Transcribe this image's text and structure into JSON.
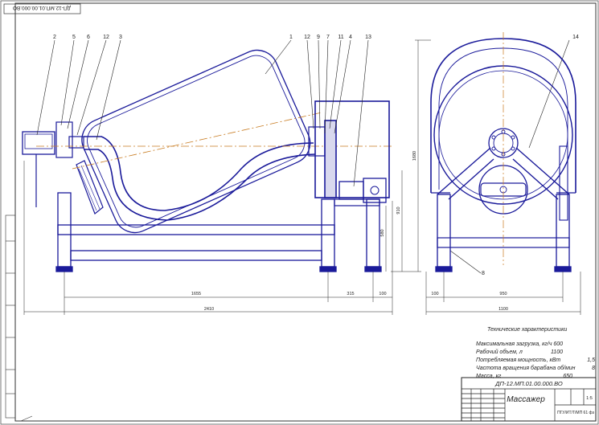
{
  "stamp_code": "ДП-12.МП.01.00.000.ВО",
  "callouts": {
    "c2": "2",
    "c5": "5",
    "c6": "6",
    "c12a": "12",
    "c3": "3",
    "c1": "1",
    "c12b": "12",
    "c9": "9",
    "c7": "7",
    "c11": "11",
    "c4": "4",
    "c13": "13",
    "c14": "14",
    "c8": "8"
  },
  "dims": {
    "d1655": "1655",
    "d315": "315",
    "d100a": "100",
    "d2410": "2410",
    "d100b": "100",
    "d950": "950",
    "d1100": "1100",
    "v1680": "1680",
    "v910": "910",
    "v580": "580"
  },
  "specs": {
    "title": "Технические характеристики",
    "rows": [
      {
        "label": "Максимальная загрузка, кг/ч",
        "value": "600"
      },
      {
        "label": "Рабочий объем, л",
        "value": "1100"
      },
      {
        "label": "Потребляемая мощность, кВт",
        "value": "1,5"
      },
      {
        "label": "Частота вращения барабана об/мин",
        "value": "8"
      },
      {
        "label": "Масса, кг",
        "value": "650"
      }
    ]
  },
  "title_block": {
    "code": "ДП-12.МП.01.00.000.ВО",
    "name": "Массажер",
    "scale": "1:5",
    "org": "ПГУ/ИТ/Т/МП 61 фз"
  }
}
